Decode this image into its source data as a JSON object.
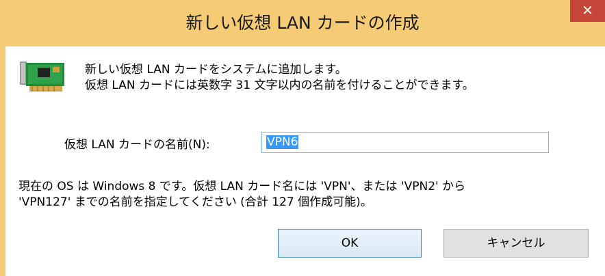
{
  "window": {
    "title": "新しい仮想 LAN カードの作成",
    "close_glyph": "✕"
  },
  "intro": {
    "line1": "新しい仮想 LAN カードをシステムに追加します。",
    "line2": "仮想 LAN カードには英数字 31 文字以内の名前を付けることができます。"
  },
  "name_field": {
    "label": "仮想 LAN カードの名前(N):",
    "value": "VPN6"
  },
  "info": {
    "line1": "現在の OS は Windows 8 です。仮想 LAN カード名には 'VPN'、または 'VPN2' から",
    "line2": "'VPN127' までの名前を指定してください (合計 127 個作成可能)。"
  },
  "buttons": {
    "ok": "OK",
    "cancel": "キャンセル"
  },
  "icons": {
    "nic": "network-card-icon",
    "close": "close-icon"
  },
  "colors": {
    "titlebar": "#f6cb76",
    "close": "#c7463a",
    "selection": "#3399ff"
  }
}
